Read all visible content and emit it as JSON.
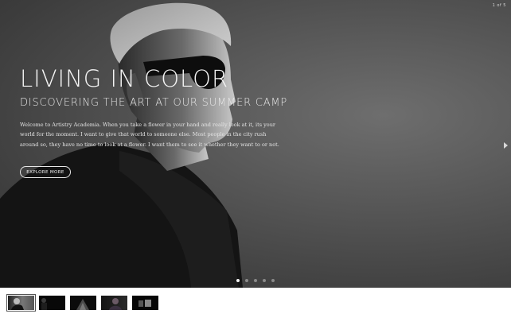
{
  "slider": {
    "counter": "1 of 5",
    "headline": "LIVING IN COLOR",
    "subheadline": "DISCOVERING THE ART AT OUR SUMMER CAMP",
    "body": "Welcome to Artistry Academia. When you take a flower in your hand and really look at it, its your world for the moment. I want to give that world to someone else. Most people in the city rush around so, they have no time to look at a flower. I want them to see it whether they want to or not.",
    "cta_label": "EXPLORE MORE",
    "next_icon": "chevron-right-icon",
    "dots": [
      {
        "active": true
      },
      {
        "active": false
      },
      {
        "active": false
      },
      {
        "active": false
      },
      {
        "active": false
      }
    ]
  },
  "thumbnails": [
    {
      "name": "thumbnail-1",
      "active": true
    },
    {
      "name": "thumbnail-2",
      "active": false
    },
    {
      "name": "thumbnail-3",
      "active": false
    },
    {
      "name": "thumbnail-4",
      "active": false
    },
    {
      "name": "thumbnail-5",
      "active": false
    }
  ]
}
